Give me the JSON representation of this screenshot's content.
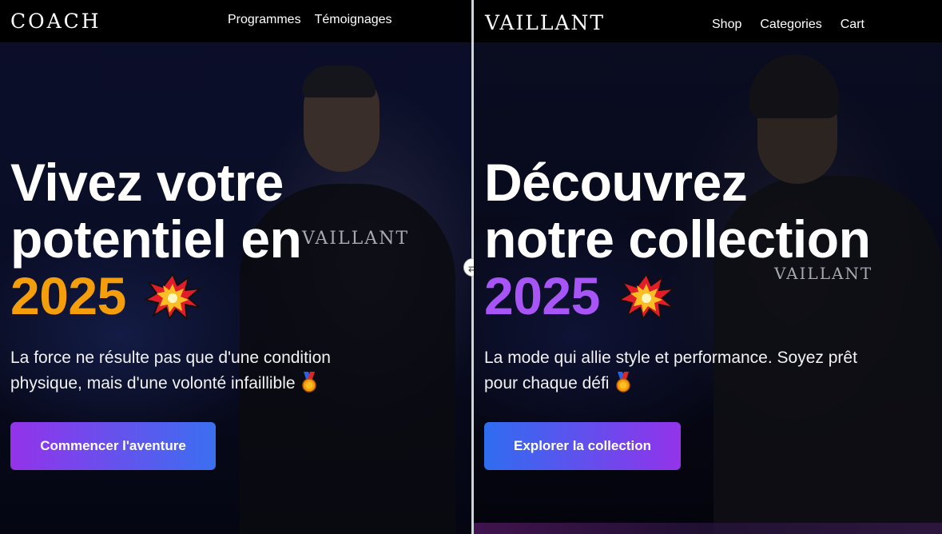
{
  "left": {
    "logo": "COACH",
    "nav": [
      "Programmes",
      "Témoignages"
    ],
    "title_line1": "Vivez votre",
    "title_line2": "potentiel en",
    "year": "2025",
    "subtitle_line1": "La force ne résulte pas que d'une condition",
    "subtitle_line2": "physique, mais d'une volonté infaillible",
    "cta_label": "Commencer l'aventure",
    "shirt_logo": "VAILLANT",
    "accent_color": "#f59e0b"
  },
  "right": {
    "logo": "VAILLANT",
    "nav": [
      "Shop",
      "Categories",
      "Cart"
    ],
    "title_line1": "Découvrez",
    "title_line2": "notre collection",
    "year": "2025",
    "subtitle_line1": "La mode qui allie style et performance. Soyez prêt",
    "subtitle_line2": "pour chaque défi",
    "cta_label": "Explorer la collection",
    "shirt_logo": "VAILLANT",
    "accent_color": "#a855f7"
  },
  "divider": {
    "handle_icon": "swap-arrows-icon",
    "handle_glyph": "⇄"
  },
  "icons": {
    "title_emoji": "collision-burst-icon",
    "subtitle_emoji": "medal-icon"
  }
}
